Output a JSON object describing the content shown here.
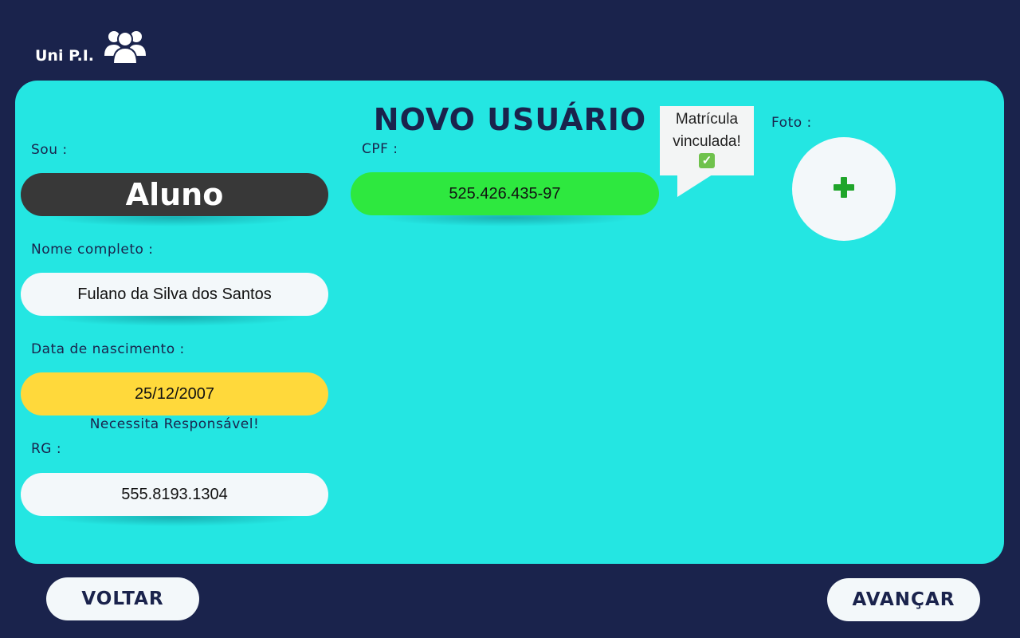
{
  "brand": {
    "name": "Uni P.I.",
    "icon": "users-group-icon"
  },
  "page": {
    "title": "NOVO USUÁRIO"
  },
  "form": {
    "role": {
      "label": "Sou  :",
      "value": "Aluno"
    },
    "full_name": {
      "label": "Nome completo  :",
      "value": "Fulano da Silva dos Santos"
    },
    "birth_date": {
      "label": "Data de nascimento  :",
      "value": "25/12/2007",
      "warning": "Necessita Responsável!"
    },
    "rg": {
      "label": "RG  :",
      "value": "555.8193.1304"
    },
    "cpf": {
      "label": "CPF  :",
      "value": "525.426.435-97"
    },
    "photo": {
      "label": "Foto  :",
      "icon": "plus-icon"
    }
  },
  "tooltip": {
    "line1": "Matrícula",
    "line2": "vinculada!",
    "icon": "check-icon"
  },
  "nav": {
    "back_label": "VOLTAR",
    "next_label": "AVANÇAR"
  },
  "colors": {
    "background": "#1a234c",
    "card": "#24e6e2",
    "role_pill": "#383838",
    "cpf_valid": "#2ee83f",
    "birth_warning": "#ffd93b",
    "field": "#f3f8fa",
    "plus": "#1fa52a"
  }
}
